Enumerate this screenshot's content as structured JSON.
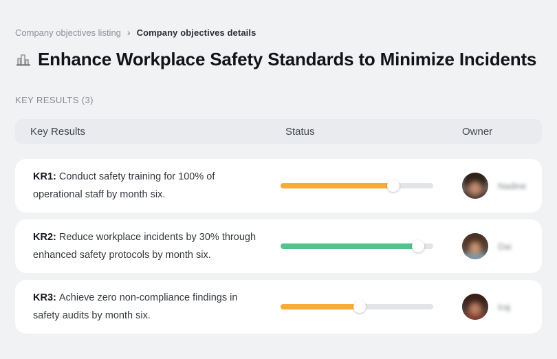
{
  "breadcrumb": {
    "items": [
      {
        "label": "Company objectives listing"
      },
      {
        "label": "Company objectives details"
      }
    ],
    "separator": "›"
  },
  "header": {
    "icon": "buildings-icon",
    "title": "Enhance Workplace Safety Standards to Minimize Incidents"
  },
  "section": {
    "label": "KEY RESULTS (3)"
  },
  "table": {
    "columns": {
      "key_results": "Key Results",
      "status": "Status",
      "owner": "Owner"
    },
    "rows": [
      {
        "kr": "KR1:",
        "text": "Conduct safety training for 100% of operational staff by month six.",
        "progress_pct": 74,
        "progress_color": "#FAAB35",
        "owner": "Nadine"
      },
      {
        "kr": "KR2:",
        "text": "Reduce workplace incidents by 30% through enhanced safety protocols by month six.",
        "progress_pct": 90,
        "progress_color": "#53C28D",
        "owner": "Dai"
      },
      {
        "kr": "KR3:",
        "text": "Achieve zero non-compliance findings in safety audits by month six.",
        "progress_pct": 52,
        "progress_color": "#FAAB35",
        "owner": "Iraj"
      }
    ]
  },
  "colors": {
    "page_bg": "#F1F2F4",
    "header_row_bg": "#E9EBEF",
    "card_bg": "#FFFFFF",
    "track": "#E3E4E7",
    "status_orange": "#FAAB35",
    "status_green": "#53C28D"
  }
}
